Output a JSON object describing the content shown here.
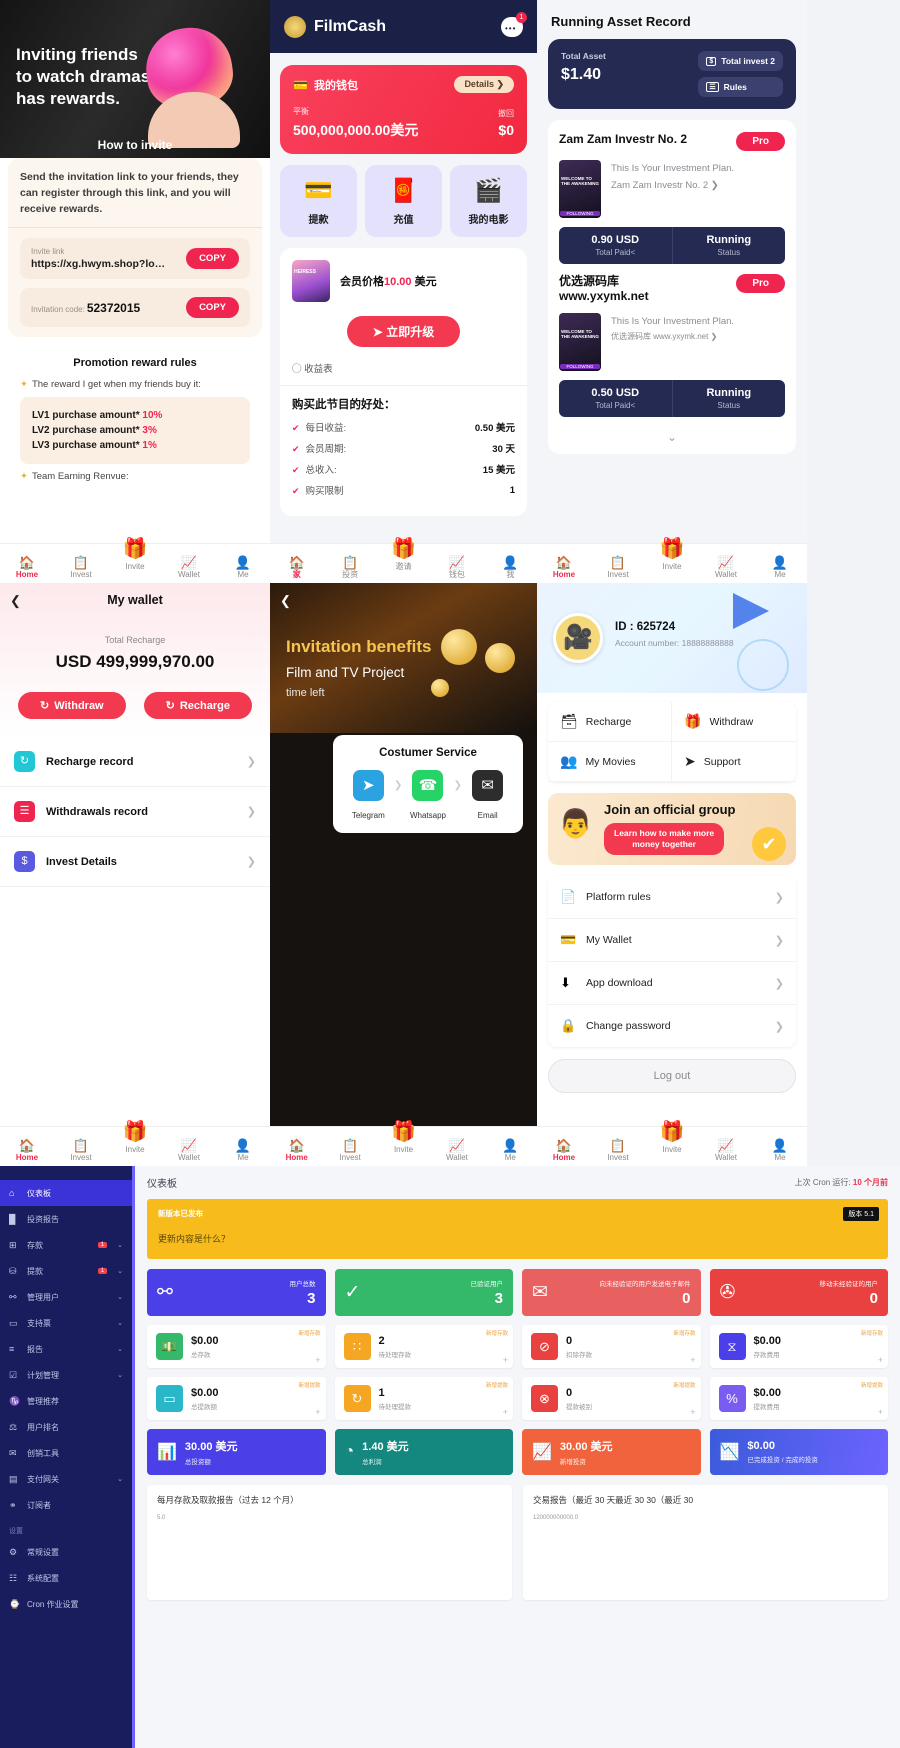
{
  "panel_invite": {
    "hero_title": "Inviting friends\nto watch dramas\nhas rewards.",
    "how_to_invite": "How to invite",
    "description": "Send the invitation link to your friends, they can register through this link, and you will receive rewards.",
    "invite_link_label": "Invite link",
    "invite_link_value": "https://xg.hwym.shop?lo…",
    "invitation_code_label": "Invitation code:",
    "invitation_code_value": "52372015",
    "copy_label": "COPY",
    "rules_title": "Promotion reward rules",
    "rule_intro": "The reward I get when my friends buy it:",
    "levels": [
      {
        "label": "LV1 purchase amount*",
        "pct": "10%"
      },
      {
        "label": "LV2 purchase amount*",
        "pct": "3%"
      },
      {
        "label": "LV3 purchase amount*",
        "pct": "1%"
      }
    ],
    "team_earning": "Team Earning Renvue:"
  },
  "nav": {
    "items": [
      {
        "label": "Home",
        "icon": "home-icon",
        "glyph": "🏠"
      },
      {
        "label": "Invest",
        "icon": "clipboard-icon",
        "glyph": "📋"
      },
      {
        "label": "Invite",
        "icon": "gift-icon",
        "glyph": "🎁"
      },
      {
        "label": "Wallet",
        "icon": "chart-icon",
        "glyph": "📈"
      },
      {
        "label": "Me",
        "icon": "person-icon",
        "glyph": "👤"
      }
    ],
    "items_cn": [
      {
        "label": "家",
        "icon": "home-icon",
        "glyph": "🏠"
      },
      {
        "label": "投资",
        "icon": "clipboard-icon",
        "glyph": "📋"
      },
      {
        "label": "邀请",
        "icon": "gift-icon",
        "glyph": "🎁"
      },
      {
        "label": "钱包",
        "icon": "chart-icon",
        "glyph": "📈"
      },
      {
        "label": "我",
        "icon": "person-icon",
        "glyph": "👤"
      }
    ]
  },
  "panel_filmcash": {
    "app_name": "FilmCash",
    "chat_badge": "1",
    "wallet_title": "我的钱包",
    "details_label": "Details",
    "balance_label": "平衡",
    "balance_value": "500,000,000.00美元",
    "withdraw_label": "撤回",
    "withdraw_value": "$0",
    "quick_actions": [
      {
        "label": "提款",
        "icon": "withdraw-icon",
        "glyph": "💳"
      },
      {
        "label": "充值",
        "icon": "recharge-icon",
        "glyph": "🧧"
      },
      {
        "label": "我的电影",
        "icon": "movie-icon",
        "glyph": "🎬"
      }
    ],
    "member_price_label": "会员价格",
    "member_price_value": "10.00",
    "member_price_unit": "美元",
    "upgrade_label": "立即升级",
    "earnings_table": "收益表",
    "benefits_title": "购买此节目的好处：",
    "benefits": [
      {
        "label": "每日收益:",
        "value": "0.50 美元"
      },
      {
        "label": "会员周期:",
        "value": "30 天"
      },
      {
        "label": "总收入:",
        "value": "15 美元"
      },
      {
        "label": "购买限制",
        "value": "1"
      }
    ]
  },
  "panel_asset": {
    "title": "Running Asset Record",
    "total_asset_label": "Total Asset",
    "total_asset_value": "$1.40",
    "total_invest_label": "Total invest 2",
    "rules_label": "Rules",
    "investments": [
      {
        "name": "Zam Zam Investr No. 2",
        "pro_label": "Pro",
        "plan_text": "This Is Your Investment Plan.",
        "plan_name": "Zam Zam Investr No. 2",
        "following": "FOLLOWING",
        "poster_text": "WELCOME TO THE AWAKENING",
        "paid_value": "0.90 USD",
        "paid_label": "Total Paid<",
        "status_value": "Running",
        "status_label": "Status"
      },
      {
        "name": "优选源码库\nwww.yxymk.net",
        "pro_label": "Pro",
        "plan_text": "This Is Your Investment Plan.",
        "plan_name": "优选源码库 www.yxymk.net",
        "following": "FOLLOWING",
        "poster_text": "WELCOME TO THE AWAKENING",
        "paid_value": "0.50 USD",
        "paid_label": "Total Paid<",
        "status_value": "Running",
        "status_label": "Status"
      }
    ]
  },
  "panel_wallet": {
    "title": "My wallet",
    "total_recharge_label": "Total Recharge",
    "total_recharge_value": "USD 499,999,970.00",
    "withdraw_label": "Withdraw",
    "recharge_label": "Recharge",
    "rows": [
      {
        "label": "Recharge record",
        "icon": "recharge-record-icon",
        "glyph": "↻",
        "color": "#22c7d6"
      },
      {
        "label": "Withdrawals record",
        "icon": "withdraw-record-icon",
        "glyph": "≡",
        "color": "#f0254f"
      },
      {
        "label": "Invest Details",
        "icon": "invest-details-icon",
        "glyph": "$",
        "color": "#5a5ae0"
      }
    ]
  },
  "panel_invitation": {
    "title": "Invitation benefits",
    "subtitle": "Film and TV Project",
    "timeleft": "time left",
    "customer_service_title": "Costumer Service",
    "channels": [
      {
        "label": "Telegram",
        "icon": "telegram-icon",
        "glyph": "➤",
        "color": "#2aa3e0"
      },
      {
        "label": "Whatsapp",
        "icon": "whatsapp-icon",
        "glyph": "✆",
        "color": "#25d366"
      },
      {
        "label": "Email",
        "icon": "email-icon",
        "glyph": "✉",
        "color": "#2d2d2d"
      }
    ]
  },
  "panel_me": {
    "id_label": "ID : 625724",
    "account_label": "Account number: 18888888888",
    "quick": [
      {
        "label": "Recharge",
        "icon": "recharge-icon",
        "glyph": "📇"
      },
      {
        "label": "Withdraw",
        "icon": "withdraw-icon",
        "glyph": "🎁"
      },
      {
        "label": "My Movies",
        "icon": "movies-icon",
        "glyph": "👥"
      },
      {
        "label": "Support",
        "icon": "support-icon",
        "glyph": "➤"
      }
    ],
    "banner_title": "Join an official group",
    "banner_button": "Learn how to make more\nmoney together",
    "list": [
      {
        "label": "Platform rules",
        "icon": "document-icon",
        "glyph": "📄"
      },
      {
        "label": "My Wallet",
        "icon": "wallet-icon",
        "glyph": "💳"
      },
      {
        "label": "App download",
        "icon": "download-icon",
        "glyph": "⬇"
      },
      {
        "label": "Change password",
        "icon": "lock-icon",
        "glyph": "🔒"
      }
    ],
    "logout": "Log out"
  },
  "admin": {
    "sidebar": [
      {
        "label": "仪表板",
        "icon": "dashboard-icon",
        "glyph": "⌂",
        "active": true
      },
      {
        "label": "投资报告",
        "icon": "report-icon",
        "glyph": "█"
      },
      {
        "label": "存款",
        "icon": "deposit-icon",
        "glyph": "⊞",
        "badge": "1",
        "caret": "⌄"
      },
      {
        "label": "提款",
        "icon": "withdraw-icon",
        "glyph": "⛁",
        "badge": "1",
        "caret": "⌄"
      },
      {
        "label": "管理用户",
        "icon": "users-icon",
        "glyph": "⛯",
        "caret": "⌄"
      },
      {
        "label": "支持票",
        "icon": "ticket-icon",
        "glyph": "▭",
        "caret": "⌄"
      },
      {
        "label": "报告",
        "icon": "reports-icon",
        "glyph": "≡",
        "caret": "⌄"
      },
      {
        "label": "计划管理",
        "icon": "plan-icon",
        "glyph": "☑",
        "caret": "⌄"
      },
      {
        "label": "管理推荐",
        "icon": "referral-icon",
        "glyph": "♑"
      },
      {
        "label": "用户排名",
        "icon": "ranking-icon",
        "glyph": "⚒"
      },
      {
        "label": "创销工具",
        "icon": "tools-icon",
        "glyph": "✉"
      },
      {
        "label": "支付网关",
        "icon": "gateway-icon",
        "glyph": "▤",
        "caret": "⌄"
      },
      {
        "label": "订阅者",
        "icon": "subscriber-icon",
        "glyph": "⚭"
      }
    ],
    "sidebar_section": "设置",
    "sidebar_settings": [
      {
        "label": "常规设置",
        "icon": "settings-icon",
        "glyph": "⚙"
      },
      {
        "label": "系统配置",
        "icon": "system-icon",
        "glyph": "☷"
      }
    ],
    "cron_footer": "Cron 作业设置",
    "header_title": "仪表板",
    "cron_label": "上次 Cron 运行:",
    "cron_value": "10 个月前",
    "notice_title": "新版本已发布",
    "notice_body": "更新内容是什么？",
    "notice_version": "版本 5.1",
    "stat_cards": [
      {
        "label": "用户总数",
        "value": "3",
        "color": "#4b3fe8",
        "icon": "users-group-icon",
        "glyph": "⛯"
      },
      {
        "label": "已验证用户",
        "value": "3",
        "color": "#34b96a",
        "icon": "verified-user-icon",
        "glyph": "✓"
      },
      {
        "label": "向未经验证的用户发送电子邮件",
        "value": "0",
        "color": "#e8605f",
        "icon": "mail-icon",
        "glyph": "✉"
      },
      {
        "label": "移动未经验证的用户",
        "value": "0",
        "color": "#e8413f",
        "icon": "no-mail-icon",
        "glyph": "⌧"
      }
    ],
    "white_cards": [
      {
        "value": "$0.00",
        "label": "总存款",
        "tag": "新增存款",
        "color": "#34b96a",
        "icon": "money-hand-icon",
        "glyph": "💵",
        "plus": "+"
      },
      {
        "value": "2",
        "label": "待处理存款",
        "tag": "新增存款",
        "color": "#f5a623",
        "icon": "pending-icon",
        "glyph": "∷",
        "plus": "+"
      },
      {
        "value": "0",
        "label": "扣除存款",
        "tag": "新增存款",
        "color": "#e8413f",
        "icon": "blocked-icon",
        "glyph": "⊘",
        "plus": "+"
      },
      {
        "value": "$0.00",
        "label": "存款费用",
        "tag": "新增存款",
        "color": "#4b3fe8",
        "icon": "fee-icon",
        "glyph": "⧖",
        "plus": "+"
      }
    ],
    "white_cards2": [
      {
        "value": "$0.00",
        "label": "总提款额",
        "tag": "新增提款",
        "color": "#2ab7c9",
        "icon": "card-icon",
        "glyph": "▭",
        "plus": "+"
      },
      {
        "value": "1",
        "label": "待处理提款",
        "tag": "新增提款",
        "color": "#f5a623",
        "icon": "refresh-icon",
        "glyph": "↻",
        "plus": "+"
      },
      {
        "value": "0",
        "label": "提款被别",
        "tag": "新增提款",
        "color": "#e8413f",
        "icon": "reject-icon",
        "glyph": "⊗",
        "plus": "+"
      },
      {
        "value": "$0.00",
        "label": "提款费用",
        "tag": "新增提款",
        "color": "#7b5cf0",
        "icon": "percent-icon",
        "glyph": "%",
        "plus": "+"
      }
    ],
    "gradient_cards": [
      {
        "value": "30.00 美元",
        "label": "总投资额",
        "color": "#4b3fe8",
        "icon": "bar-chart-icon",
        "glyph": "📊"
      },
      {
        "value": "1.40 美元",
        "label": "总利润",
        "color": "#14877f",
        "icon": "clock-icon",
        "glyph": "◔"
      },
      {
        "value": "30.00 美元",
        "label": "新增投资",
        "color": "#f0633c",
        "icon": "trend-icon",
        "glyph": "📈"
      },
      {
        "value": "$0.00",
        "label": "已完成投资 / 完成的投资",
        "color": "#3b5bdb",
        "icon": "line-chart-icon",
        "glyph": "📉"
      }
    ],
    "charts": [
      {
        "title": "每月存款及取款报告（过去 12 个月）",
        "ytick": "5.0"
      },
      {
        "title": "交易报告（最近 30 天最近 30 30（最近 30",
        "ytick": "120000000000.0"
      }
    ]
  }
}
